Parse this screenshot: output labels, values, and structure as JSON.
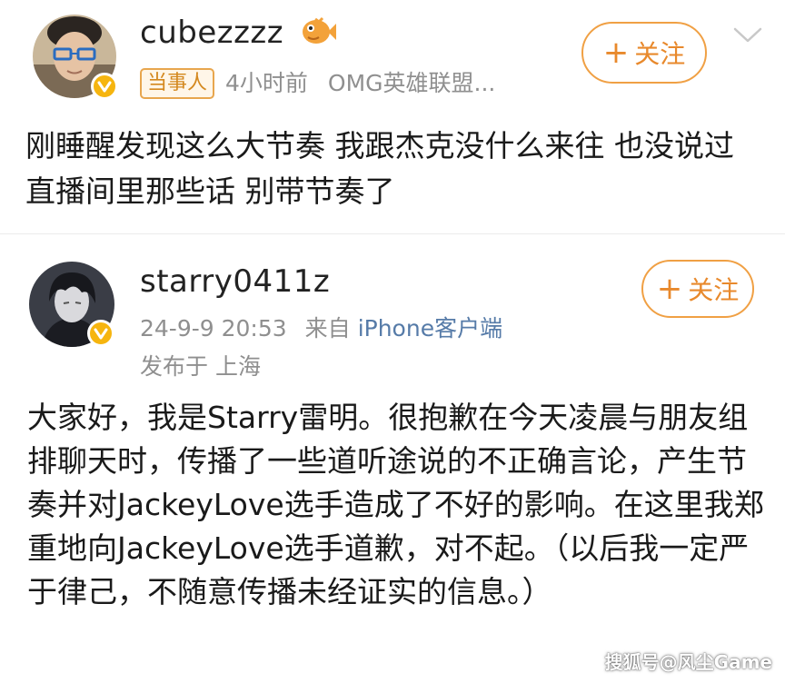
{
  "posts": [
    {
      "username": "cubezzzz",
      "role_badge": "当事人",
      "time": "4小时前",
      "source": "OMG英雄联盟...",
      "follow_label": "关注",
      "follow_plus": "+",
      "body": "刚睡醒发现这么大节奏 我跟杰克没什么来往 也没说过直播间里那些话 别带节奏了"
    },
    {
      "username": "starry0411z",
      "time": "24-9-9 20:53",
      "from_prefix": "来自",
      "source": "iPhone客户端",
      "location": "发布于 上海",
      "follow_label": "关注",
      "follow_plus": "+",
      "body": "大家好，我是Starry雷明。很抱歉在今天凌晨与朋友组排聊天时，传播了一些道听途说的不正确言论，产生节奏并对JackeyLove选手造成了不好的影响。在这里我郑重地向JackeyLove选手道歉，对不起。（以后我一定严于律己，不随意传播未经证实的信息。）"
    }
  ],
  "watermark": "搜狐号@风尘Game",
  "colors": {
    "accent_orange": "#f0a044",
    "verified_gold": "#f6b50f",
    "source_blue": "#567ba8",
    "meta_gray": "#8f8f8f"
  },
  "icons": [
    "verified-badge-icon",
    "fish-emoji-icon",
    "chevron-down-icon",
    "plus-icon"
  ]
}
